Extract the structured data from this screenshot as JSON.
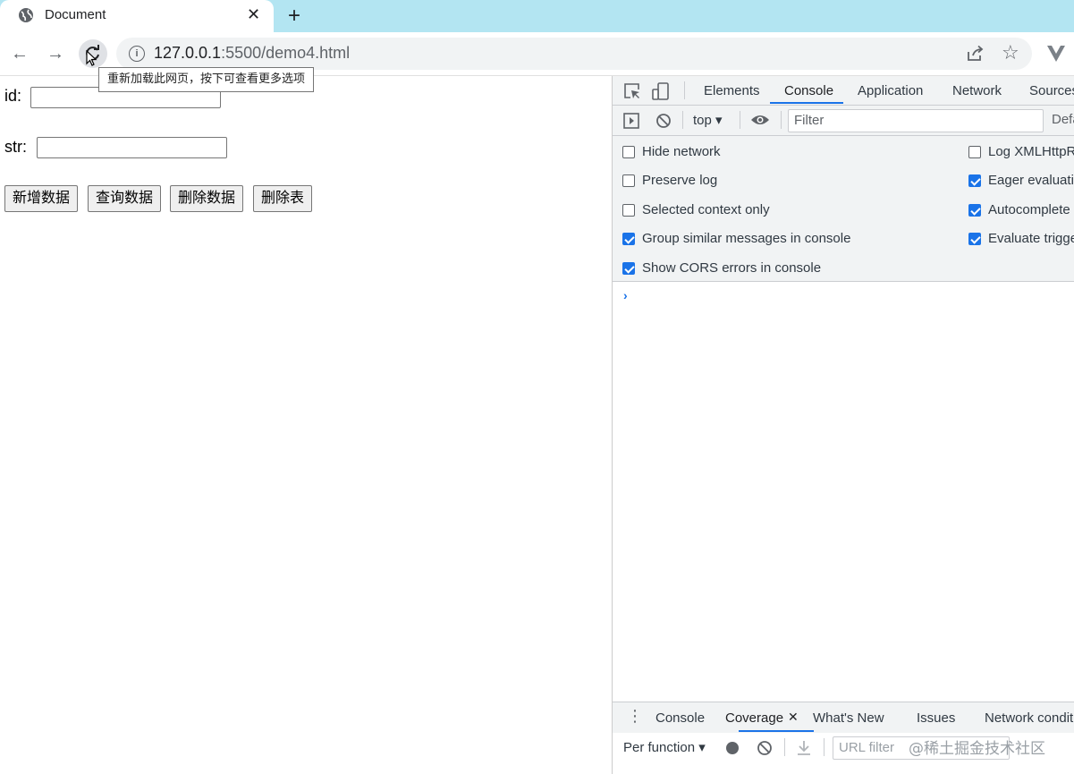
{
  "browser": {
    "tab_title": "Document",
    "url_host": "127.0.0.1",
    "url_rest": ":5500/demo4.html",
    "reload_tooltip": "重新加载此网页，按下可查看更多选项"
  },
  "page": {
    "id_label": "id:",
    "str_label": "str:",
    "buttons": [
      "新增数据",
      "查询数据",
      "删除数据",
      "删除表"
    ]
  },
  "devtools": {
    "tabs": [
      "Elements",
      "Console",
      "Application",
      "Network",
      "Sources"
    ],
    "active_tab": "Console",
    "context": "top",
    "filter_placeholder": "Filter",
    "levels_label": "Defa",
    "settings_left": [
      {
        "label": "Hide network",
        "checked": false
      },
      {
        "label": "Preserve log",
        "checked": false
      },
      {
        "label": "Selected context only",
        "checked": false
      },
      {
        "label": "Group similar messages in console",
        "checked": true
      },
      {
        "label": "Show CORS errors in console",
        "checked": true
      }
    ],
    "settings_right": [
      {
        "label": "Log XMLHttpR",
        "checked": false
      },
      {
        "label": "Eager evaluatio",
        "checked": true
      },
      {
        "label": "Autocomplete",
        "checked": true
      },
      {
        "label": "Evaluate trigge",
        "checked": true
      }
    ],
    "prompt": "›",
    "drawer_tabs": [
      "Console",
      "Coverage",
      "What's New",
      "Issues",
      "Network condit"
    ],
    "drawer_active": "Coverage",
    "coverage_mode": "Per function",
    "url_filter_placeholder": "URL filter"
  },
  "watermark": "@稀土掘金技术社区",
  "colors": {
    "tabstrip": "#b3e5f2",
    "accent": "#1a73e8"
  }
}
